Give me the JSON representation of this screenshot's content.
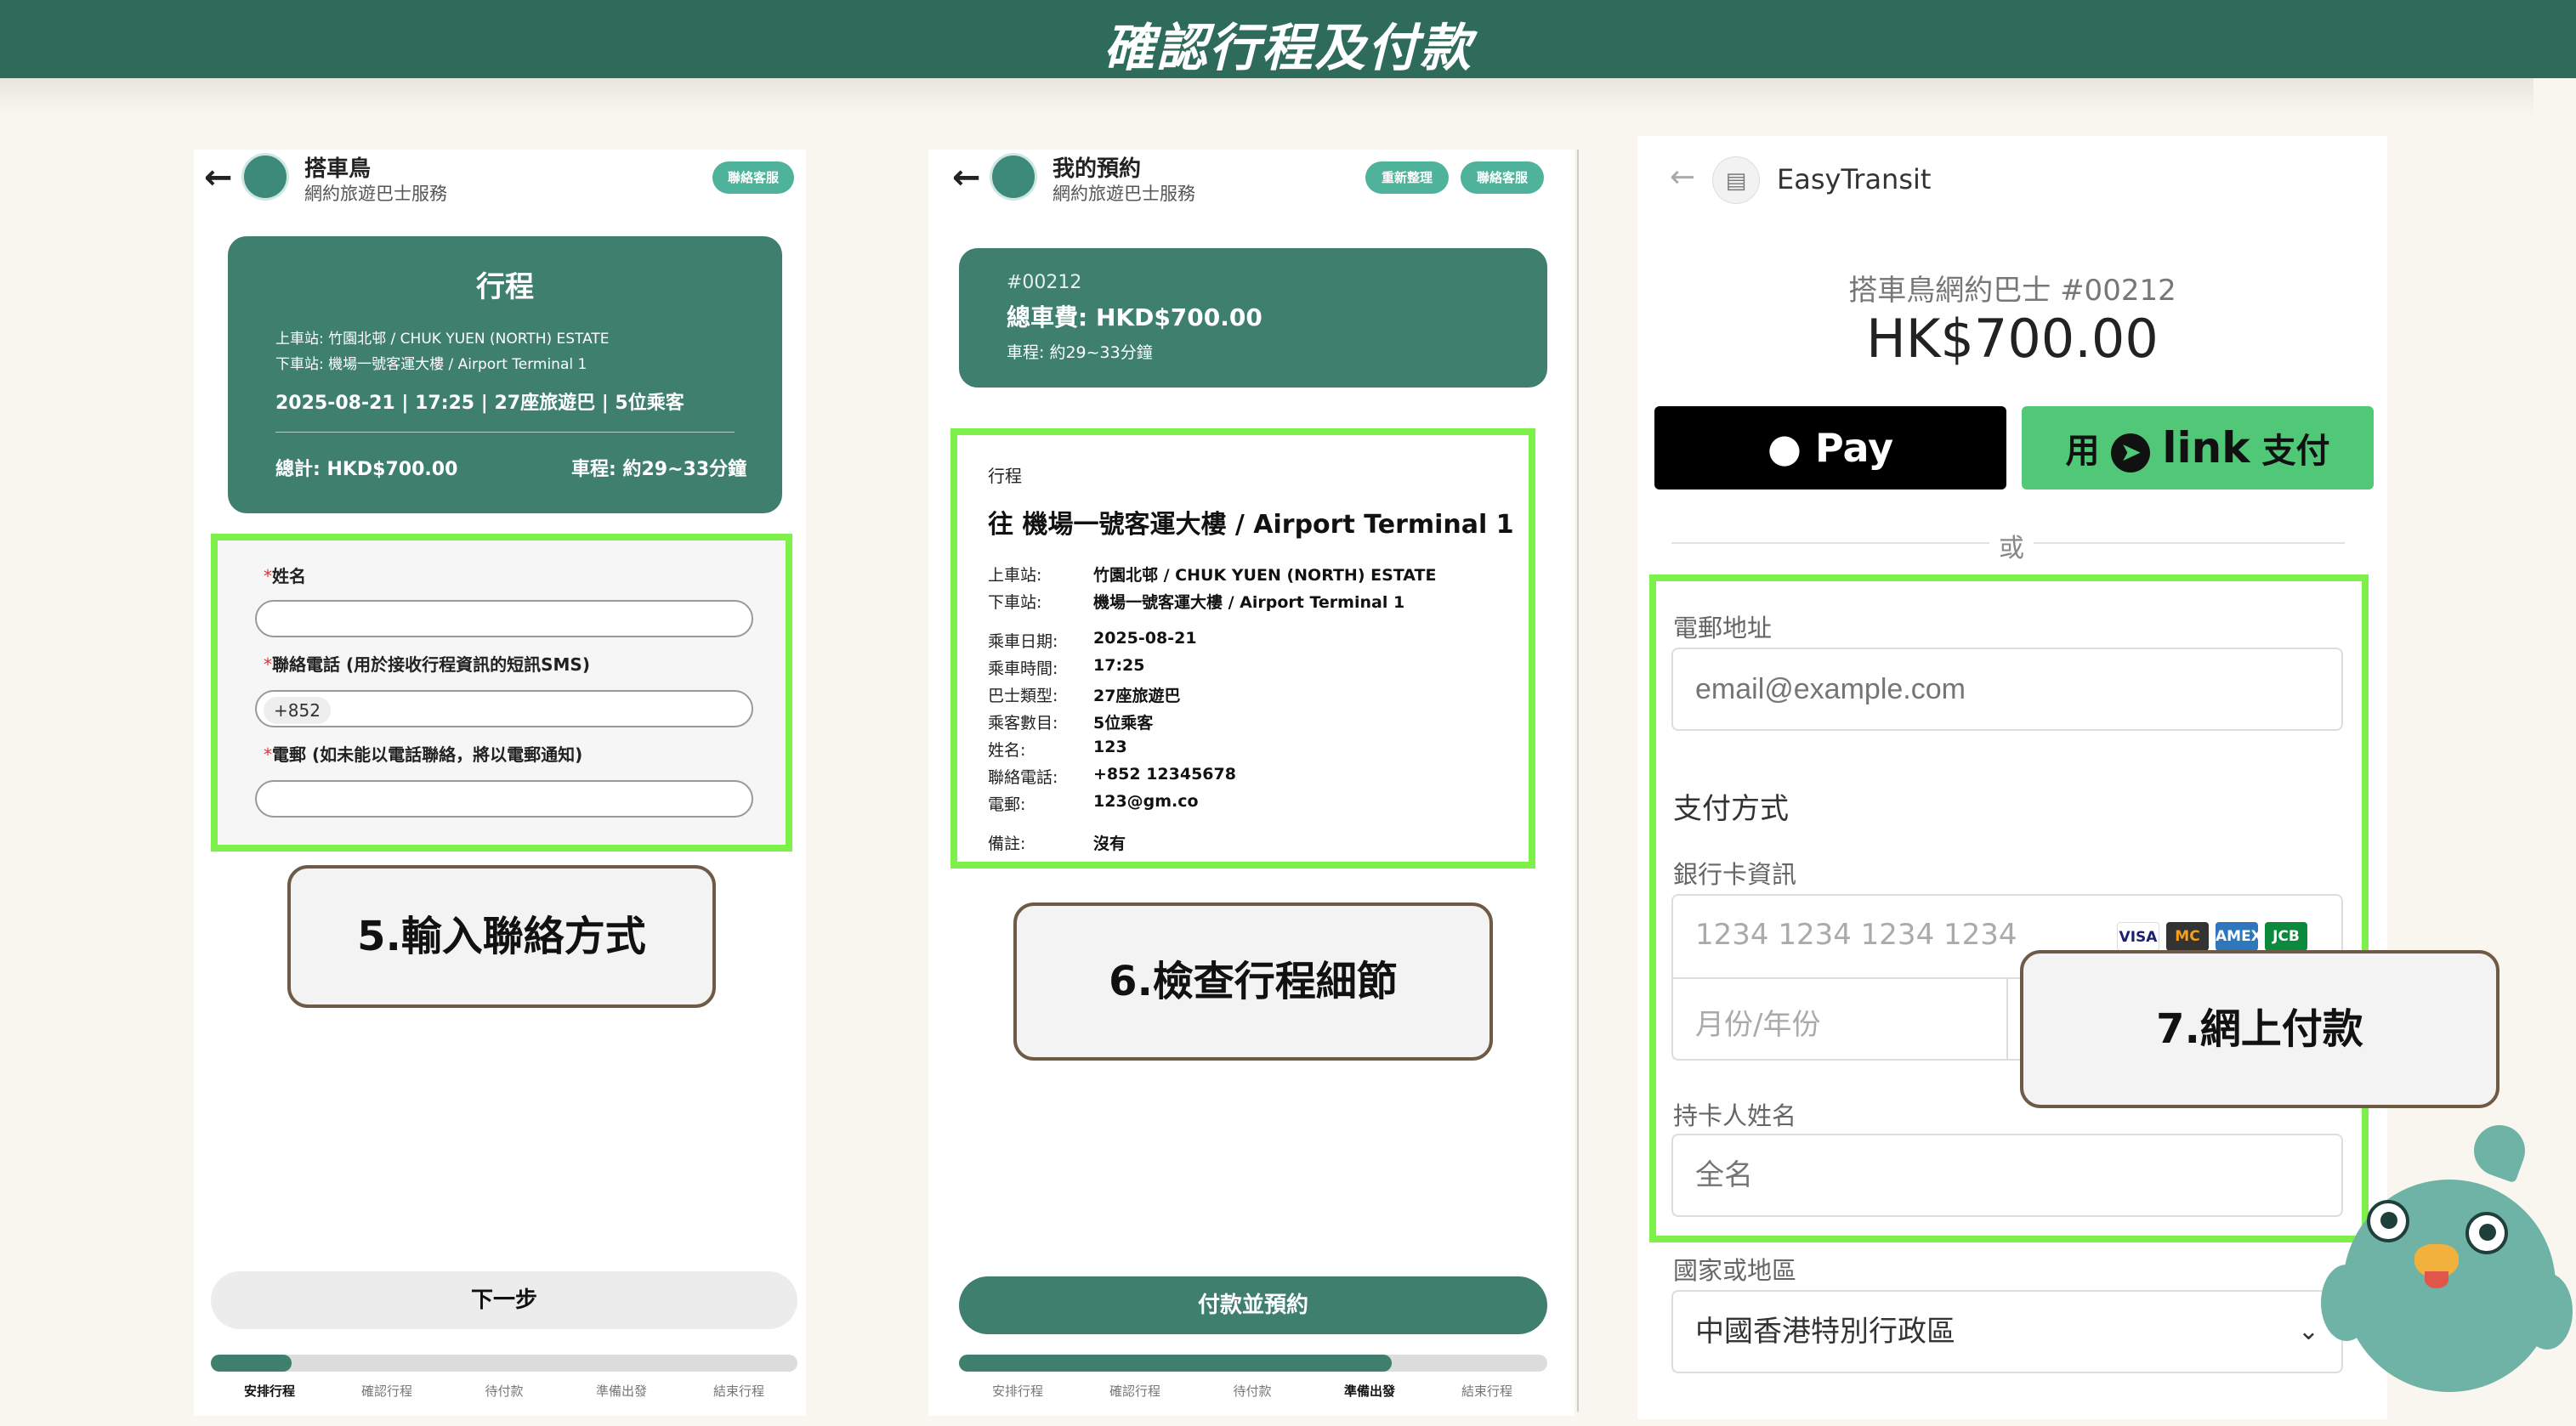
{
  "page_title": "確認行程及付款",
  "panel1": {
    "app_title": "搭車鳥",
    "app_sub": "網約旅遊巴士服務",
    "contact_btn": "聯絡客服",
    "card": {
      "title": "行程",
      "pickup": "上車站: 竹園北邨 / CHUK YUEN (NORTH) ESTATE",
      "dropoff": "下車站: 機場一號客運大樓 / Airport Terminal 1",
      "info_line": "2025-08-21 | 17:25 | 27座旅遊巴 | 5位乘客",
      "total": "總計: HKD$700.00",
      "duration": "車程: 約29~33分鐘"
    },
    "form": {
      "name_label": "姓名",
      "phone_label": "聯絡電話 (用於接收行程資訊的短訊SMS)",
      "phone_prefix": "+852",
      "email_label": "電郵 (如未能以電話聯絡，將以電郵通知)",
      "required_mark": "*"
    },
    "callout": "5.輸入聯絡方式",
    "next_btn": "下一步",
    "progress": 0.2,
    "steps": [
      "安排行程",
      "確認行程",
      "待付款",
      "準備出發",
      "結束行程"
    ]
  },
  "panel2": {
    "app_title": "我的預約",
    "app_sub": "網約旅遊巴士服務",
    "refresh_btn": "重新整理",
    "contact_btn": "聯絡客服",
    "card": {
      "order_no": "#00212",
      "fare": "總車費: HKD$700.00",
      "duration": "車程: 約29~33分鐘"
    },
    "detail": {
      "section": "行程",
      "destination": "往 機場一號客運大樓 / Airport Terminal 1",
      "rows_a": [
        {
          "k": "上車站:",
          "v": "竹園北邨 / CHUK YUEN (NORTH) ESTATE"
        },
        {
          "k": "下車站:",
          "v": "機場一號客運大樓 / Airport Terminal 1"
        }
      ],
      "rows_b": [
        {
          "k": "乘車日期:",
          "v": "2025-08-21"
        },
        {
          "k": "乘車時間:",
          "v": "17:25"
        },
        {
          "k": "巴士類型:",
          "v": "27座旅遊巴"
        },
        {
          "k": "乘客數目:",
          "v": "5位乘客"
        },
        {
          "k": "姓名:",
          "v": "123"
        },
        {
          "k": "聯絡電話:",
          "v": "+852 12345678"
        },
        {
          "k": "電郵:",
          "v": "123@gm.co"
        }
      ],
      "remark_k": "備註:",
      "remark_v": "沒有"
    },
    "callout": "6.檢查行程細節",
    "pay_btn": "付款並預約",
    "progress": 0.8,
    "steps": [
      "安排行程",
      "確認行程",
      "待付款",
      "準備出發",
      "結束行程"
    ]
  },
  "panel3": {
    "brand": "EasyTransit",
    "product": "搭車鳥網約巴士 #00212",
    "price": "HK$700.00",
    "apple_pay": "Pay",
    "link_pay_pre": "用",
    "link_pay_word": "link",
    "link_pay_post": "支付",
    "or": "或",
    "email_label": "電郵地址",
    "email_placeholder": "email@example.com",
    "pay_method": "支付方式",
    "card_info_label": "銀行卡資訊",
    "card_placeholder": "1234 1234 1234 1234",
    "card_logos": [
      "VISA",
      "MC",
      "AMEX",
      "JCB"
    ],
    "expiry_placeholder": "月份/年份",
    "holder_label": "持卡人姓名",
    "holder_placeholder": "全名",
    "country_label": "國家或地區",
    "country_value": "中國香港特別行政區",
    "callout": "7.網上付款"
  },
  "colors": {
    "brand_green": "#2e6b5a",
    "card_green": "#3e7f6e",
    "highlight": "#7ef04a",
    "link_green": "#50c878"
  }
}
